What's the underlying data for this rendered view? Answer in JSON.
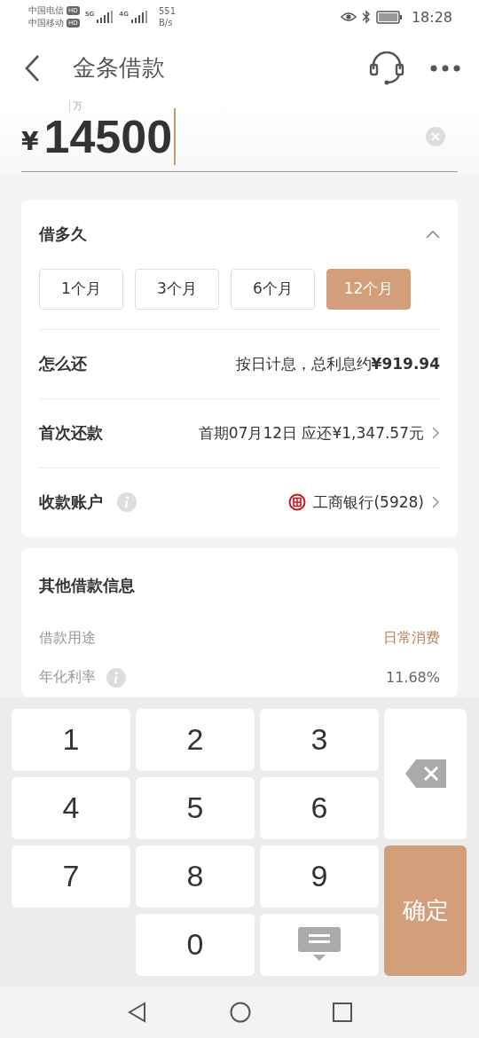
{
  "status_bar": {
    "carriers": [
      {
        "name": "中国电信",
        "badge": "HD"
      },
      {
        "name": "中国移动",
        "badge": "HD"
      }
    ],
    "networks": [
      "5G",
      "4G"
    ],
    "speed": "551",
    "speed_unit": "B/s",
    "time": "18:28"
  },
  "header": {
    "title": "金条借款"
  },
  "amount": {
    "unit_hint": "万",
    "currency": "¥",
    "value": "14500"
  },
  "loan_card": {
    "title": "借多久",
    "expanded": true,
    "terms": [
      {
        "label": "1个月",
        "selected": false
      },
      {
        "label": "3个月",
        "selected": false
      },
      {
        "label": "6个月",
        "selected": false
      },
      {
        "label": "12个月",
        "selected": true
      }
    ],
    "rows": [
      {
        "label": "怎么还",
        "value": "按日计息，总利息约**¥919.94**",
        "info": false,
        "chevron": false,
        "bank": false
      },
      {
        "label": "首次还款",
        "value": "首期07月12日 应还¥1,347.57元",
        "info": false,
        "chevron": true,
        "bank": false
      },
      {
        "label": "收款账户",
        "value": "工商银行(5928)",
        "info": true,
        "chevron": true,
        "bank": true
      }
    ]
  },
  "other_card": {
    "title": "其他借款信息",
    "rows": [
      {
        "label": "借款用途",
        "value": "日常消费",
        "info": false,
        "highlight": true
      },
      {
        "label": "年化利率",
        "value": "11.68%",
        "info": true,
        "highlight": false
      }
    ]
  },
  "keypad": {
    "digits": [
      "1",
      "2",
      "3",
      "4",
      "5",
      "6",
      "7",
      "8",
      "9",
      "0"
    ],
    "confirm": "确定"
  }
}
